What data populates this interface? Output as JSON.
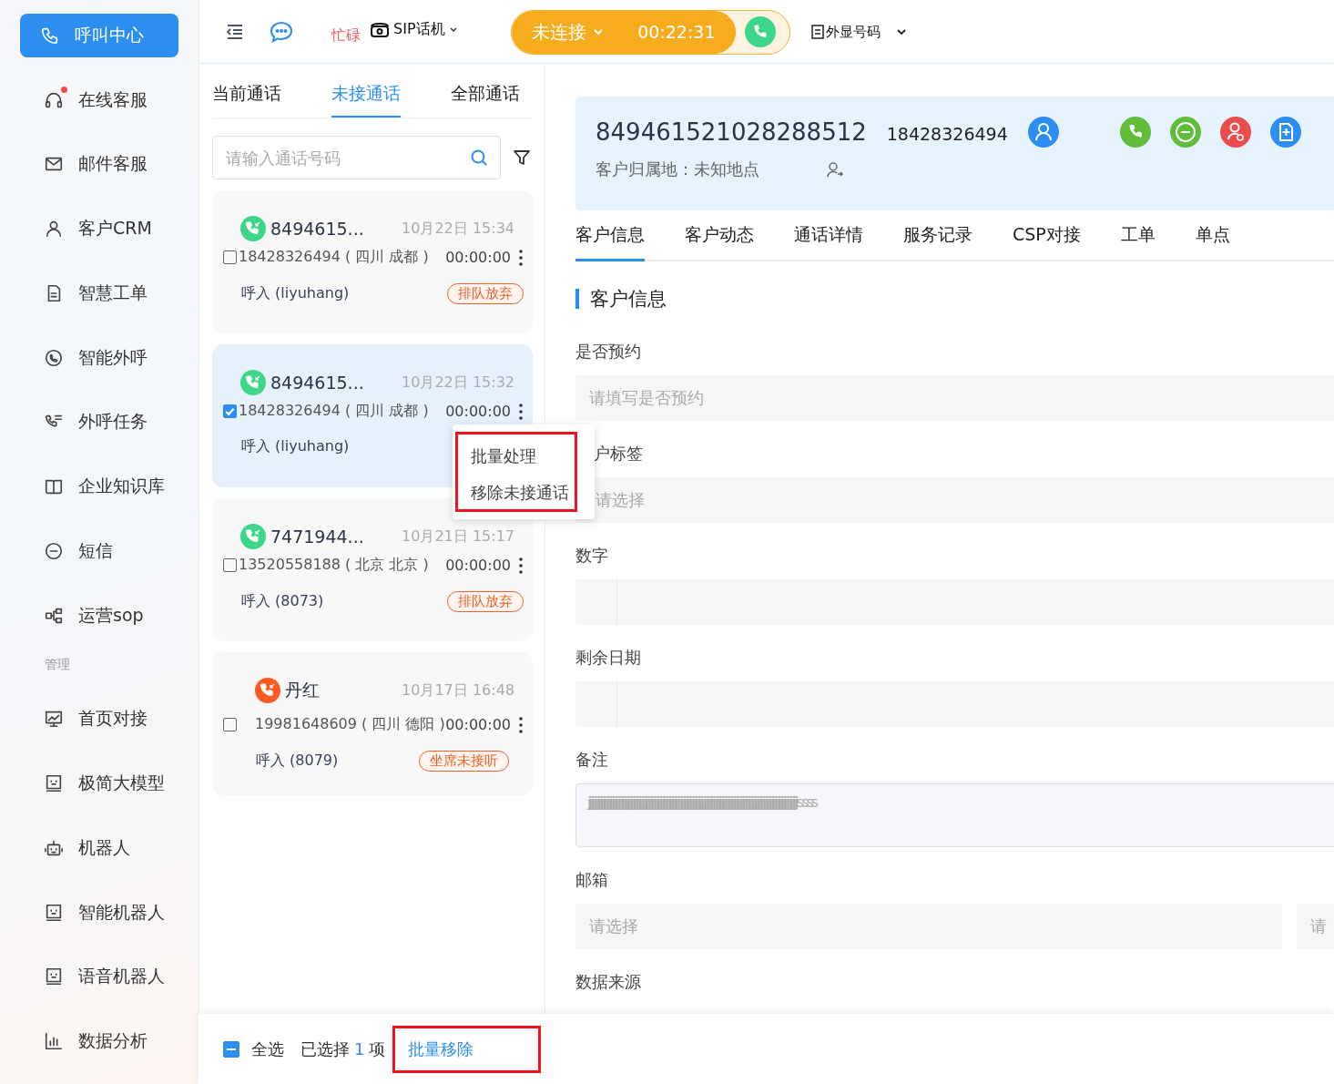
{
  "sidebar": {
    "items": [
      {
        "kind": "item",
        "label": "呼叫中心",
        "selected": true,
        "dot": false
      },
      {
        "kind": "item",
        "label": "在线客服",
        "selected": false,
        "dot": true
      },
      {
        "kind": "item",
        "label": "邮件客服",
        "selected": false,
        "dot": false
      },
      {
        "kind": "item",
        "label": "客户CRM",
        "selected": false,
        "dot": false
      },
      {
        "kind": "item",
        "label": "智慧工单",
        "selected": false,
        "dot": false
      },
      {
        "kind": "item",
        "label": "智能外呼",
        "selected": false,
        "dot": false
      },
      {
        "kind": "item",
        "label": "外呼任务",
        "selected": false,
        "dot": false
      },
      {
        "kind": "item",
        "label": "企业知识库",
        "selected": false,
        "dot": false
      },
      {
        "kind": "item",
        "label": "短信",
        "selected": false,
        "dot": false
      },
      {
        "kind": "item",
        "label": "运营sop",
        "selected": false,
        "dot": false
      },
      {
        "kind": "section",
        "label": "管理"
      },
      {
        "kind": "item",
        "label": "首页对接",
        "selected": false,
        "dot": false
      },
      {
        "kind": "item",
        "label": "极简大模型",
        "selected": false,
        "dot": false
      },
      {
        "kind": "item",
        "label": "机器人",
        "selected": false,
        "dot": false
      },
      {
        "kind": "item",
        "label": "智能机器人",
        "selected": false,
        "dot": false
      },
      {
        "kind": "item",
        "label": "语音机器人",
        "selected": false,
        "dot": false
      },
      {
        "kind": "item",
        "label": "数据分析",
        "selected": false,
        "dot": false
      }
    ]
  },
  "topbar": {
    "agent_status": "忙碌",
    "phone_type": "SIP话机",
    "call_status": "未连接",
    "timer": "00:22:31",
    "caller_id": "外显号码"
  },
  "call_tabs": [
    {
      "label": "当前通话",
      "selected": false
    },
    {
      "label": "未接通话",
      "selected": true
    },
    {
      "label": "全部通话",
      "selected": false
    }
  ],
  "search": {
    "placeholder": "请输入通话号码"
  },
  "calls": [
    {
      "name": "8494615...",
      "time": "10月22日 15:34",
      "number": "18428326494 ( 四川 成都 )",
      "duration": "00:00:00",
      "direction": "呼入 (liyuhang)",
      "tag": "排队放弃",
      "checked": false,
      "selected": false,
      "color": "#3ed68a"
    },
    {
      "name": "8494615...",
      "time": "10月22日 15:32",
      "number": "18428326494 ( 四川 成都 )",
      "duration": "00:00:00",
      "direction": "呼入 (liyuhang)",
      "checked": true,
      "selected": true,
      "color": "#3ed68a"
    },
    {
      "name": "7471944...",
      "time": "10月21日 15:17",
      "number": "13520558188 ( 北京 北京 )",
      "duration": "00:00:00",
      "direction": "呼入 (8073)",
      "tag": "排队放弃",
      "checked": false,
      "selected": false,
      "color": "#3ed68a"
    },
    {
      "name": "丹红",
      "time": "10月17日 16:48",
      "number": "19981648609 ( 四川 德阳 )",
      "duration": "00:00:00",
      "direction": "呼入 (8079)",
      "tag": "坐席未接听",
      "checked": false,
      "selected": false,
      "color": "#fa5a24"
    }
  ],
  "context_menu": {
    "items": [
      "批量处理",
      "移除未接通话"
    ]
  },
  "customer": {
    "id": "849461521028288512",
    "phone": "18428326494",
    "location": "客户归属地：未知地点"
  },
  "detail_tabs": [
    {
      "label": "客户信息",
      "selected": true
    },
    {
      "label": "客户动态",
      "selected": false
    },
    {
      "label": "通话详情",
      "selected": false
    },
    {
      "label": "服务记录",
      "selected": false
    },
    {
      "label": "CSP对接",
      "selected": false
    },
    {
      "label": "工单",
      "selected": false
    },
    {
      "label": "单点",
      "selected": false
    }
  ],
  "section_title": "客户信息",
  "fields": [
    {
      "kind": "input",
      "label": "是否预约",
      "placeholder": "请填写是否预约"
    },
    {
      "kind": "select",
      "label": "户标签",
      "placeholder": "请选择"
    },
    {
      "kind": "number",
      "label": "数字"
    },
    {
      "kind": "number",
      "label": "剩余日期"
    },
    {
      "kind": "textarea",
      "label": "备注",
      "value": "jjjjjjjjjjjjjjjjjjjjjjjjjjjjjjjjjjjjjjjjjjjjjjjjjjjjjjjjjjjjjjjjjjjjjjjjjjjjjjjjjjjjjjjjjjjjjjjjjjjjjjjjjjjjjjjjjjjjjjjjjjjjjjjjjjjjjjjjjjjjjjjjjjjjjjjjjjjjjjjssss"
    },
    {
      "kind": "pair",
      "label": "邮箱",
      "placeholder": "请选择",
      "placeholder_2": "请"
    },
    {
      "kind": "label",
      "label": "数据来源"
    }
  ],
  "bottom_bar": {
    "select_all": "全选",
    "indeterminate": true,
    "selected_prefix": "已选择",
    "selected_count": "1",
    "selected_suffix": "项",
    "action": "批量移除"
  }
}
